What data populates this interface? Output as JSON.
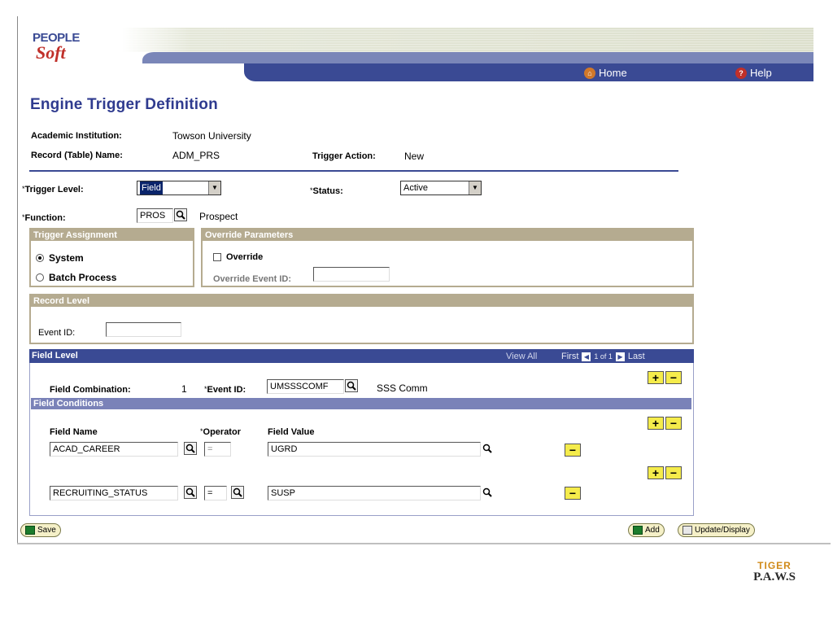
{
  "header": {
    "logo_text_1": "PEOPLE",
    "logo_text_2": "Soft",
    "home_label": "Home",
    "help_label": "Help"
  },
  "page": {
    "title": "Engine Trigger Definition"
  },
  "info": {
    "institution_label": "Academic Institution:",
    "institution_value": "Towson University",
    "record_label": "Record (Table) Name:",
    "record_value": "ADM_PRS",
    "action_label": "Trigger Action:",
    "action_value": "New"
  },
  "form": {
    "trigger_level_label": "Trigger Level:",
    "trigger_level_value": "Field",
    "status_label": "Status:",
    "status_value": "Active",
    "function_label": "Function:",
    "function_value": "PROS",
    "function_desc": "Prospect",
    "required_mark": "*"
  },
  "trigger_assignment": {
    "title": "Trigger Assignment",
    "opt_system": "System",
    "opt_batch": "Batch Process",
    "selected": "System"
  },
  "override": {
    "title": "Override Parameters",
    "checkbox_label": "Override",
    "event_label": "Override Event ID:",
    "event_value": ""
  },
  "record_level": {
    "title": "Record Level",
    "event_label": "Event ID:",
    "event_value": ""
  },
  "field_level": {
    "title": "Field Level",
    "view_all": "View All",
    "first": "First",
    "range": "1 of 1",
    "last": "Last",
    "combo_label": "Field Combination:",
    "combo_value": "1",
    "event_label": "Event ID:",
    "event_value": "UMSSSCOMF",
    "event_desc": "SSS Comm"
  },
  "field_conditions": {
    "title": "Field Conditions",
    "col_name": "Field Name",
    "col_operator": "Operator",
    "col_value": "Field Value",
    "rows": [
      {
        "name": "ACAD_CAREER",
        "operator": "=",
        "value": "UGRD"
      },
      {
        "name": "RECRUITING_STATUS",
        "operator": "=",
        "value": "SUSP"
      }
    ]
  },
  "footer": {
    "save_label": "Save",
    "add_label": "Add",
    "update_label": "Update/Display"
  },
  "branding": {
    "line1": "TIGER",
    "line2": "P.A.W.S"
  },
  "colors": {
    "title_blue": "#2f3b8f",
    "header_blue": "#3a4a94",
    "group_tan": "#b5ab90",
    "button_yellow": "#f5ec4b"
  },
  "icons": [
    "home-icon",
    "help-icon",
    "lookup-icon",
    "dropdown-arrow-icon",
    "save-icon",
    "add-icon",
    "update-icon",
    "nav-prev-icon",
    "nav-next-icon"
  ]
}
